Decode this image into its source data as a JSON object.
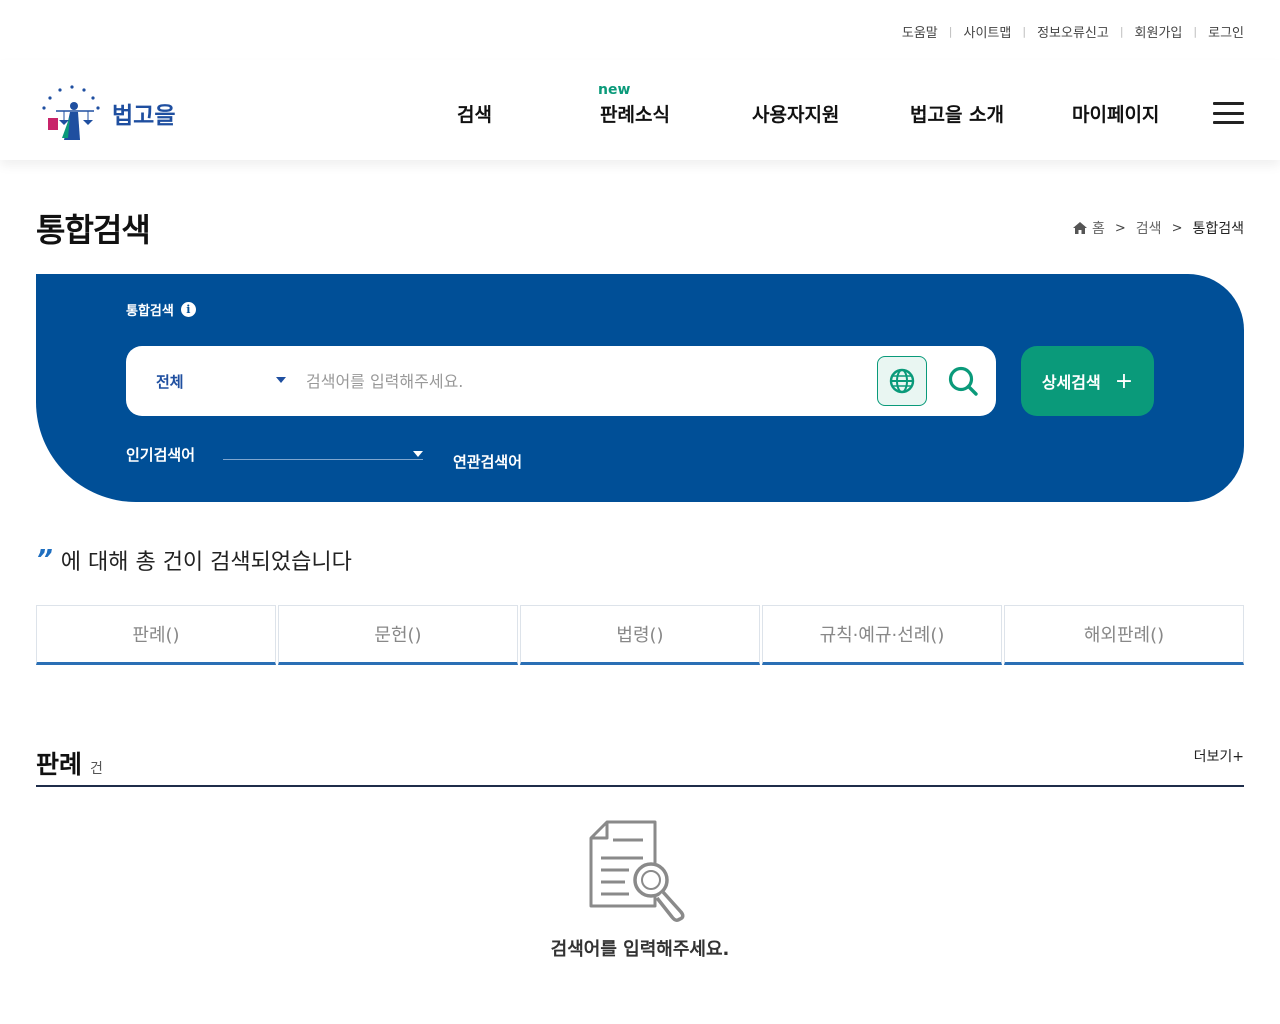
{
  "util_links": [
    "도움말",
    "사이트맵",
    "정보오류신고",
    "회원가입",
    "로그인"
  ],
  "header": {
    "logo_text": "법고을",
    "logo_ring_text": "대한민국법원",
    "nav": {
      "search": "검색",
      "new_badge": "new",
      "news": "판례소식",
      "support": "사용자지원",
      "about": "법고을 소개",
      "mypage": "마이페이지"
    }
  },
  "page": {
    "title": "통합검색",
    "breadcrumb": {
      "home": "홈",
      "level1": "검색",
      "current": "통합검색"
    }
  },
  "search": {
    "label": "통합검색",
    "info_icon": "i",
    "scope": "전체",
    "placeholder": "검색어를 입력해주세요.",
    "advanced_label": "상세검색",
    "advanced_icon": "+",
    "popular_label": "인기검색어",
    "related_label": "연관검색어"
  },
  "summary": {
    "quote": "”",
    "text": "에 대해 총 건이 검색되었습니다"
  },
  "tabs": [
    "판례()",
    "문헌()",
    "법령()",
    "규칙·예규·선례()",
    "해외판례()"
  ],
  "section": {
    "title": "판례",
    "count": "건",
    "more": "더보기+"
  },
  "empty": {
    "message": "검색어를 입력해주세요."
  },
  "colors": {
    "primary": "#004f97",
    "accent": "#0a9a7a",
    "tab_underline": "#2a6fb5"
  }
}
